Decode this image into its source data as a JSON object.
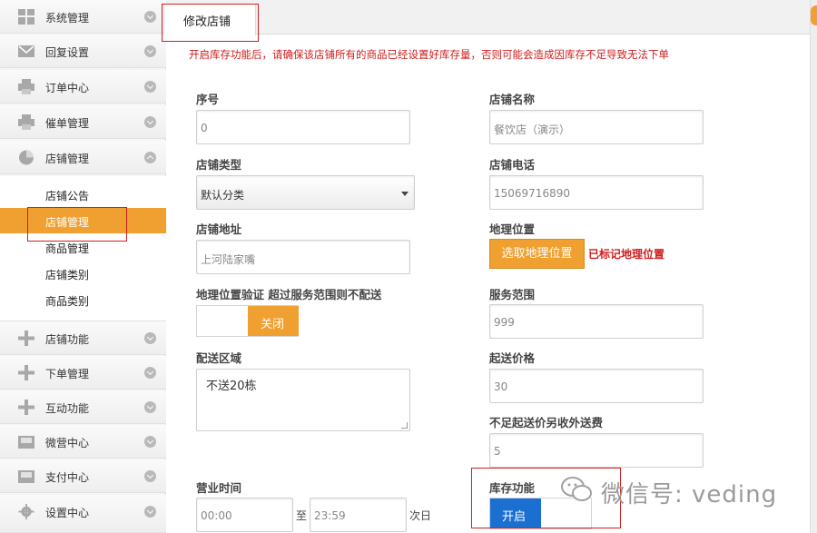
{
  "sidebar": {
    "items": [
      {
        "label": "系统管理",
        "icon": "grid-icon"
      },
      {
        "label": "回复设置",
        "icon": "envelope-icon"
      },
      {
        "label": "订单中心",
        "icon": "printer-icon"
      },
      {
        "label": "催单管理",
        "icon": "printer-icon"
      },
      {
        "label": "店铺管理",
        "icon": "clock-pie-icon",
        "expanded": true
      },
      {
        "label": "店铺功能",
        "icon": "plus-icon"
      },
      {
        "label": "下单管理",
        "icon": "plus-icon"
      },
      {
        "label": "互动功能",
        "icon": "plus-icon"
      },
      {
        "label": "微营中心",
        "icon": "inbox-icon"
      },
      {
        "label": "支付中心",
        "icon": "inbox-icon"
      },
      {
        "label": "设置中心",
        "icon": "gear-icon"
      }
    ],
    "submenu": [
      "店铺公告",
      "店铺管理",
      "商品管理",
      "店铺类别",
      "商品类别"
    ],
    "active_submenu": "店铺管理"
  },
  "tab": {
    "label": "修改店铺"
  },
  "warning": "开启库存功能后，请确保该店铺所有的商品已经设置好库存量，否则可能会造成因库存不足导致无法下单",
  "form": {
    "seq": {
      "label": "序号",
      "value": "0"
    },
    "name": {
      "label": "店铺名称",
      "value": "餐饮店（演示）"
    },
    "type": {
      "label": "店铺类型",
      "value": "默认分类"
    },
    "phone": {
      "label": "店铺电话",
      "value": "15069716890"
    },
    "address": {
      "label": "店铺地址",
      "value": "上河陆家嘴"
    },
    "geo": {
      "label": "地理位置",
      "button": "选取地理位置",
      "status": "已标记地理位置"
    },
    "geo_verify": {
      "label": "地理位置验证 超过服务范围则不配送",
      "toggle": "关闭"
    },
    "service_range": {
      "label": "服务范围",
      "value": "999"
    },
    "delivery_area": {
      "label": "配送区域",
      "value": "不送20栋"
    },
    "min_price": {
      "label": "起送价格",
      "value": "30"
    },
    "extra_fee": {
      "label": "不足起送价另收外送费",
      "value": "5"
    },
    "hours": {
      "label": "营业时间",
      "start": "00:00",
      "sep": "至",
      "end": "23:59",
      "suffix": "次日"
    },
    "stock": {
      "label": "库存功能",
      "toggle": "开启"
    }
  },
  "watermark": "微信号: veding",
  "colors": {
    "accent": "#f0a030",
    "toggle_on": "#1a6fd0",
    "warning": "#d01c1c",
    "highlight_box": "#d02020"
  }
}
